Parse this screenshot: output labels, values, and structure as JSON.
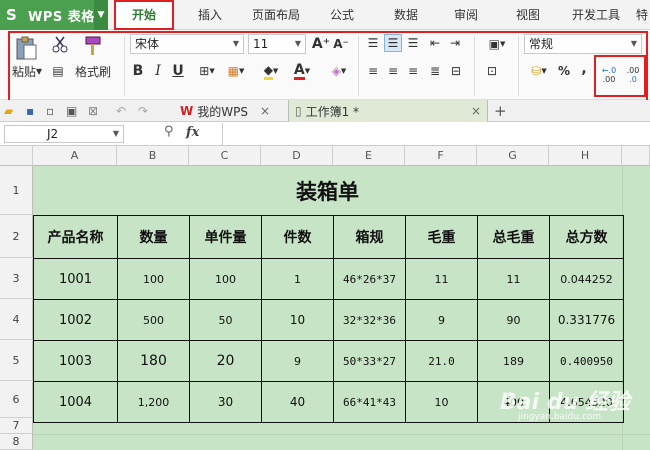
{
  "app": {
    "title": "WPS 表格"
  },
  "menu": {
    "tabs": [
      "开始",
      "插入",
      "页面布局",
      "公式",
      "数据",
      "审阅",
      "视图",
      "开发工具",
      "特"
    ]
  },
  "ribbon": {
    "paste_label": "粘贴",
    "format_painter_label": "格式刷",
    "font_name": "宋体",
    "font_size": "11",
    "bold": "B",
    "italic": "I",
    "underline": "U",
    "font_color_glyph": "A",
    "number_format": "常规",
    "percent": "%",
    "comma": ",",
    "inc_decimal": ".00",
    "dec_decimal": ".0",
    "grow_font": "A⁺",
    "shrink_font": "A⁻"
  },
  "doc_tabs": {
    "wps_label": "我的WPS",
    "book_label": "工作簿1 *",
    "close": "×",
    "add": "+"
  },
  "formula_bar": {
    "cell_ref": "J2",
    "fx": "fx",
    "value": ""
  },
  "columns": [
    "A",
    "B",
    "C",
    "D",
    "E",
    "F",
    "G",
    "H"
  ],
  "rows": [
    "1",
    "2",
    "3",
    "4",
    "5",
    "6",
    "7",
    "8"
  ],
  "sheet": {
    "title": "装箱单",
    "headers": [
      "产品名称",
      "数量",
      "单件量",
      "件数",
      "箱规",
      "毛重",
      "总毛重",
      "总方数"
    ],
    "data": [
      [
        "1001",
        "100",
        "100",
        "1",
        "46*26*37",
        "11",
        "11",
        "0.044252"
      ],
      [
        "1002",
        "500",
        "50",
        "10",
        "32*32*36",
        "9",
        "90",
        "0.331776"
      ],
      [
        "1003",
        "180",
        "20",
        "9",
        "50*33*27",
        "21.0",
        "189",
        "0.400950"
      ],
      [
        "1004",
        "1,200",
        "30",
        "40",
        "66*41*43",
        "10",
        "400",
        "4.654320"
      ]
    ]
  },
  "watermark": {
    "brand": "Bai du 经验",
    "url": "jingyan.baidu.com"
  },
  "colors": {
    "wps_green": "#4aa04e",
    "grid_bg": "#c8e4c6",
    "highlight_red": "#e02020"
  }
}
